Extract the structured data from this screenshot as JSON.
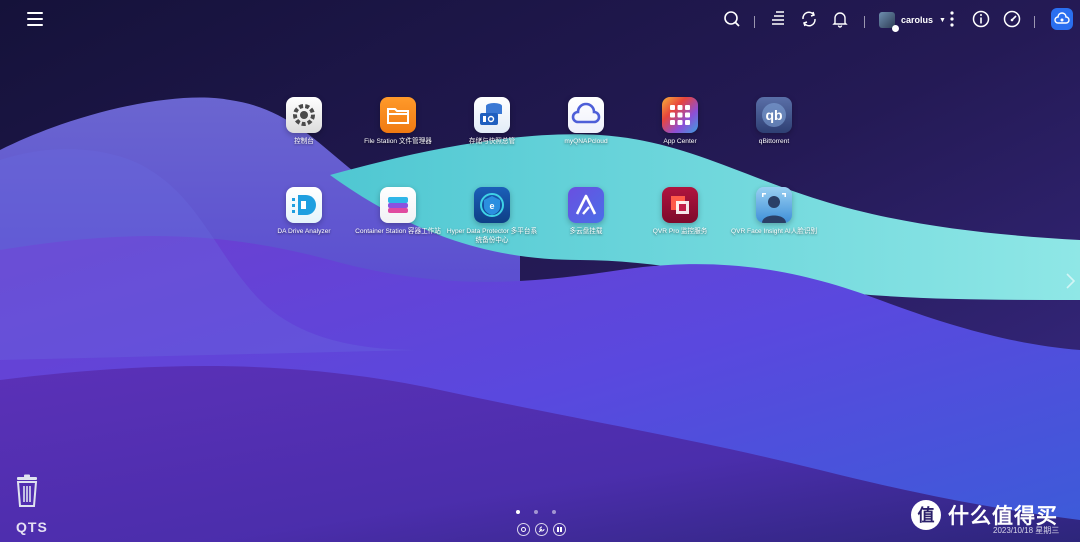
{
  "topbar": {
    "username": "carolus",
    "icons": [
      "menu-icon",
      "search-icon",
      "task-queue-icon",
      "sync-icon",
      "notification-bell-icon",
      "user-avatar",
      "more-options-icon",
      "info-icon",
      "dashboard-gauge-icon",
      "myqnapcloud-icon"
    ]
  },
  "apps": [
    {
      "label": "控制台",
      "icon": "control-panel-icon"
    },
    {
      "label": "File Station 文件管理器",
      "icon": "file-station-icon"
    },
    {
      "label": "存储与快照总管",
      "icon": "storage-snapshots-icon"
    },
    {
      "label": "myQNAPcloud",
      "icon": "myqnapcloud-icon"
    },
    {
      "label": "App Center",
      "icon": "app-center-icon"
    },
    {
      "label": "qBittorrent",
      "icon": "qbittorrent-icon"
    },
    {
      "label": "DA Drive Analyzer",
      "icon": "da-drive-analyzer-icon"
    },
    {
      "label": "Container Station 容器工作站",
      "icon": "container-station-icon"
    },
    {
      "label": "Hyper Data Protector 多平台系统备份中心",
      "icon": "hyper-data-protector-icon"
    },
    {
      "label": "多云盘挂载",
      "icon": "multicloud-mount-icon"
    },
    {
      "label": "QVR Pro 监控服务",
      "icon": "qvr-pro-icon"
    },
    {
      "label": "QVR Face Insight AI人脸识别",
      "icon": "qvr-face-icon"
    }
  ],
  "bottom": {
    "logo": "QTS",
    "date": "2023/10/18 星期三",
    "pages": 3,
    "active_page": 1,
    "watermark": "什么值得买"
  },
  "colors": {
    "accent": "#2a6ff0",
    "wallpaper_dark": "#1a1238",
    "wallpaper_purple": "#5b3fd6",
    "wallpaper_teal": "#6fd8dc"
  }
}
